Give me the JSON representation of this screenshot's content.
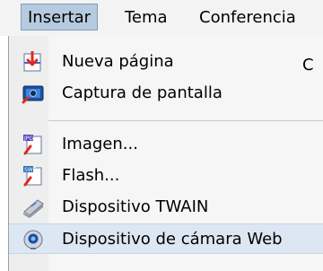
{
  "menubar": {
    "items": [
      {
        "label": "Insertar"
      },
      {
        "label": "Tema"
      },
      {
        "label": "Conferencia"
      }
    ]
  },
  "dropdown": {
    "items": [
      {
        "label": "Nueva página",
        "icon": "new-page-icon"
      },
      {
        "label": "Captura de pantalla",
        "icon": "screenshot-icon"
      },
      {
        "label": "Imagen...",
        "icon": "image-file-icon"
      },
      {
        "label": "Flash...",
        "icon": "flash-file-icon"
      },
      {
        "label": "Dispositivo TWAIN",
        "icon": "scanner-icon"
      },
      {
        "label": "Dispositivo de cámara Web",
        "icon": "webcam-icon"
      }
    ],
    "truncated_shortcut": "C"
  },
  "colors": {
    "menubar_bg": "#f3f3f3",
    "active_menu_bg": "#b7cbe0",
    "highlight_bg": "#dde7f3",
    "dropdown_bg": "#f6f6f6"
  }
}
